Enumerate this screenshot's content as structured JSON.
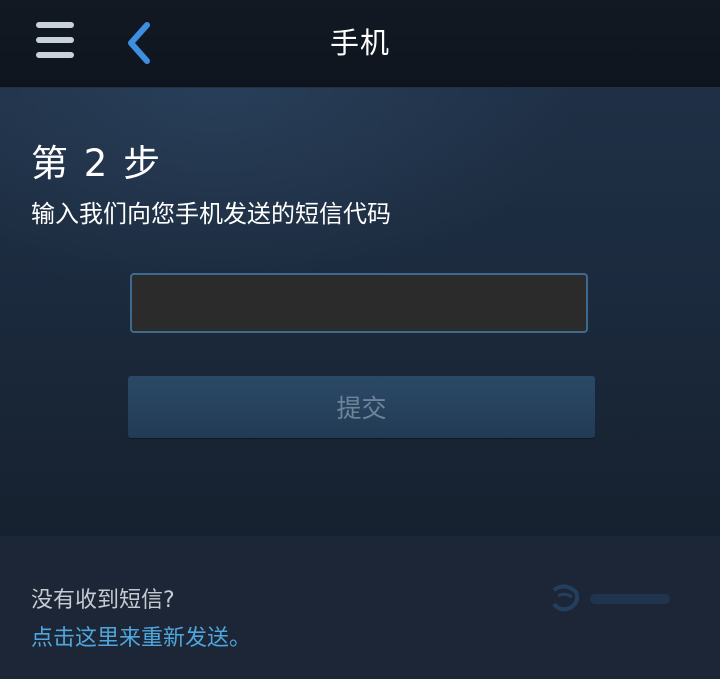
{
  "header": {
    "title": "手机",
    "menu_icon": "hamburger-menu-icon",
    "back_icon": "chevron-left-icon"
  },
  "main": {
    "step_title": "第 2 步",
    "step_description": "输入我们向您手机发送的短信代码",
    "code_input": {
      "value": "",
      "placeholder": ""
    },
    "submit_label": "提交"
  },
  "footer": {
    "question": "没有收到短信?",
    "resend_link": "点击这里来重新发送。"
  },
  "colors": {
    "accent": "#4fa6dc",
    "back_arrow": "#3d8fe0",
    "header_bg": "#0e151e",
    "panel_bg": "#1f3046",
    "button_bg": "#2b4966",
    "button_text": "#6e8499"
  }
}
